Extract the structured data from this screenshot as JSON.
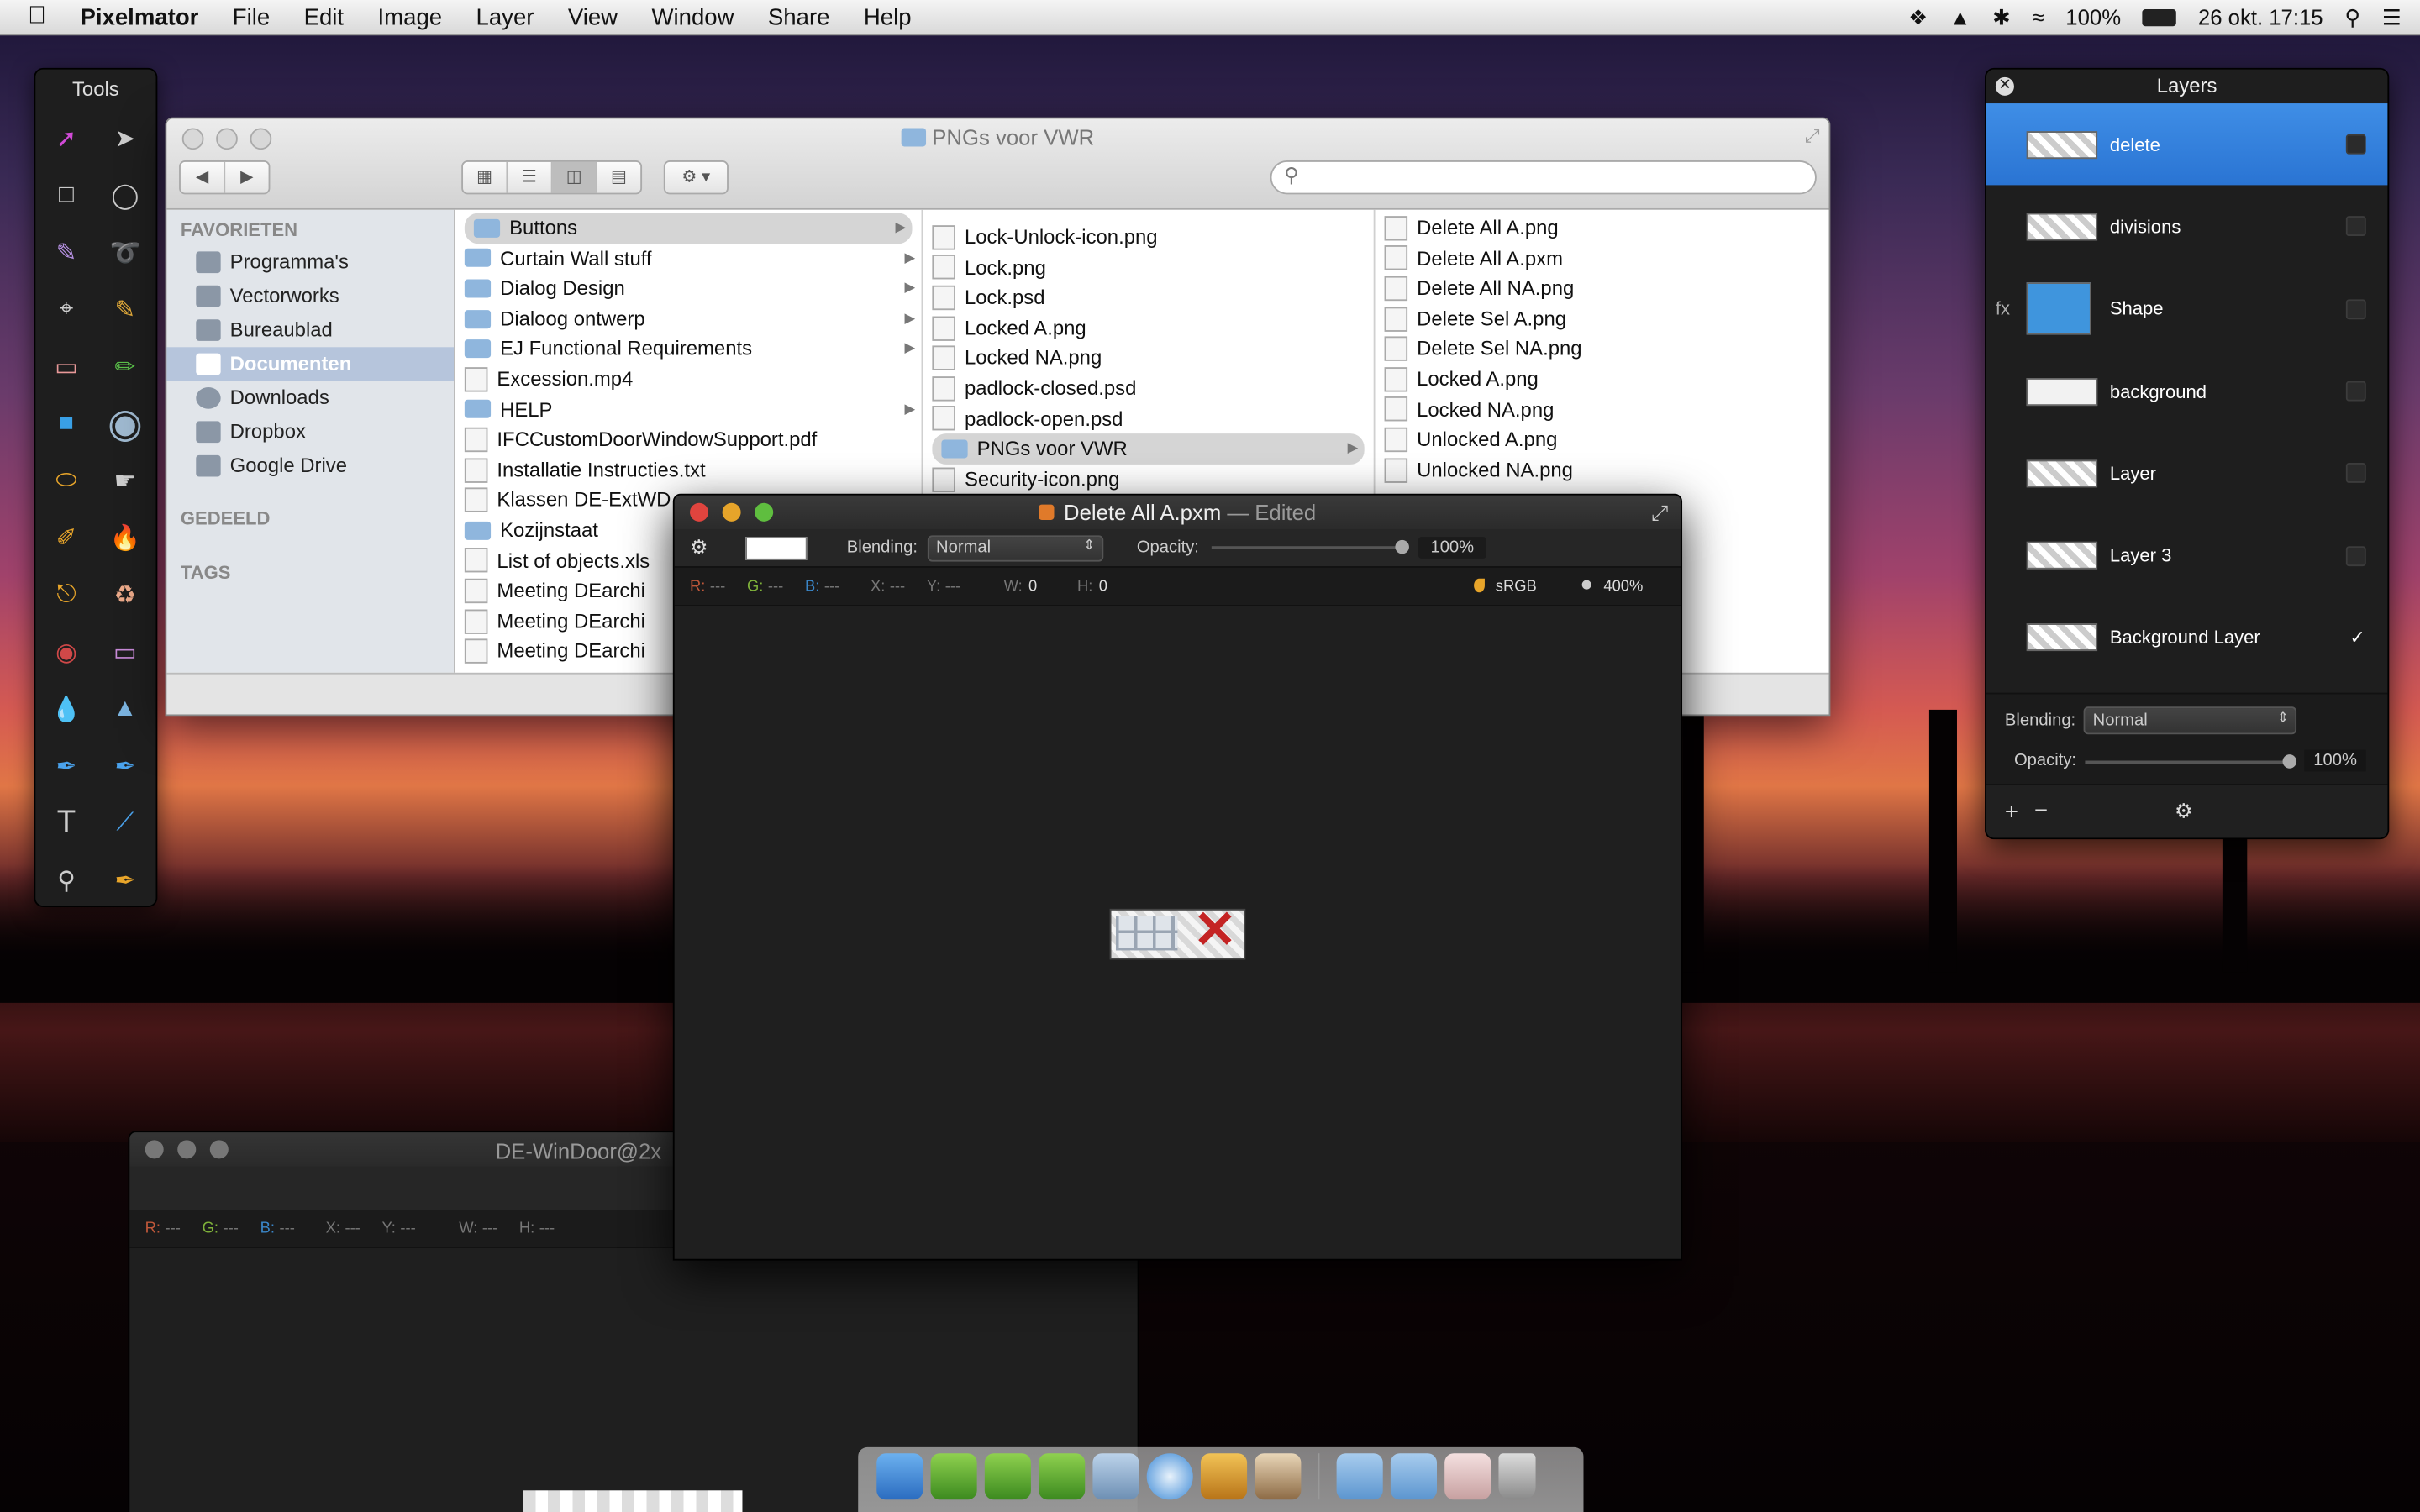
{
  "menubar": {
    "app": "Pixelmator",
    "menus": [
      "File",
      "Edit",
      "Image",
      "Layer",
      "View",
      "Window",
      "Share",
      "Help"
    ],
    "battery": "100%",
    "datetime": "26 okt. 17:15"
  },
  "tools": {
    "title": "Tools"
  },
  "finder": {
    "title": "PNGs voor VWR",
    "sidebar": {
      "favorites_header": "FAVORIETEN",
      "items": [
        "Programma's",
        "Vectorworks",
        "Bureaublad",
        "Documenten",
        "Downloads",
        "Dropbox",
        "Google Drive"
      ],
      "selected": "Documenten",
      "shared_header": "GEDEELD",
      "tags_header": "TAGS"
    },
    "col1": [
      {
        "name": "Buttons",
        "type": "folder",
        "sel": true,
        "arrow": true
      },
      {
        "name": "Curtain Wall stuff",
        "type": "folder",
        "arrow": true
      },
      {
        "name": "Dialog Design",
        "type": "folder",
        "arrow": true
      },
      {
        "name": "Dialoog ontwerp",
        "type": "folder",
        "arrow": true
      },
      {
        "name": "EJ Functional Requirements",
        "type": "folder",
        "arrow": true
      },
      {
        "name": "Excession.mp4",
        "type": "file"
      },
      {
        "name": "HELP",
        "type": "folder",
        "arrow": true
      },
      {
        "name": "IFCCustomDoorWindowSupport.pdf",
        "type": "file"
      },
      {
        "name": "Installatie Instructies.txt",
        "type": "file"
      },
      {
        "name": "Klassen DE-ExtWD",
        "type": "file"
      },
      {
        "name": "Kozijnstaat",
        "type": "folder"
      },
      {
        "name": "List of objects.xls",
        "type": "file"
      },
      {
        "name": "Meeting DEarchi",
        "type": "file"
      },
      {
        "name": "Meeting DEarchi",
        "type": "file"
      },
      {
        "name": "Meeting DEarchi",
        "type": "file"
      }
    ],
    "col2": [
      {
        "name": "Lock-Unlock-icon.png",
        "type": "file"
      },
      {
        "name": "Lock.png",
        "type": "file"
      },
      {
        "name": "Lock.psd",
        "type": "file"
      },
      {
        "name": "Locked A.png",
        "type": "file"
      },
      {
        "name": "Locked NA.png",
        "type": "file"
      },
      {
        "name": "padlock-closed.psd",
        "type": "file"
      },
      {
        "name": "padlock-open.psd",
        "type": "file"
      },
      {
        "name": "PNGs voor VWR",
        "type": "folder",
        "sel": true,
        "arrow": true
      },
      {
        "name": "Security-icon.png",
        "type": "file"
      }
    ],
    "col3": [
      {
        "name": "Delete All A.png",
        "type": "file"
      },
      {
        "name": "Delete All A.pxm",
        "type": "file"
      },
      {
        "name": "Delete All NA.png",
        "type": "file"
      },
      {
        "name": "Delete Sel A.png",
        "type": "file"
      },
      {
        "name": "Delete Sel NA.png",
        "type": "file"
      },
      {
        "name": "Locked A.png",
        "type": "file"
      },
      {
        "name": "Locked NA.png",
        "type": "file"
      },
      {
        "name": "Unlocked A.png",
        "type": "file"
      },
      {
        "name": "Unlocked NA.png",
        "type": "file"
      }
    ]
  },
  "doc": {
    "title": "Delete All A.pxm",
    "edited": "Edited",
    "blending_label": "Blending:",
    "blending_value": "Normal",
    "opacity_label": "Opacity:",
    "opacity_value": "100%",
    "r": "R:",
    "g": "G:",
    "b": "B:",
    "x": "X:",
    "y": "Y:",
    "dash": "---",
    "w_label": "W:",
    "w_value": "0",
    "h_label": "H:",
    "h_value": "0",
    "colorspace": "sRGB",
    "zoom": "400%"
  },
  "doc2": {
    "title": "DE-WinDoor@2x"
  },
  "layers": {
    "title": "Layers",
    "items": [
      {
        "name": "delete",
        "sel": true,
        "checked": false
      },
      {
        "name": "divisions",
        "checked": false
      },
      {
        "name": "Shape",
        "fx": true,
        "checked": false
      },
      {
        "name": "background",
        "checked": false
      },
      {
        "name": "Layer",
        "checked": false
      },
      {
        "name": "Layer 3",
        "checked": false
      },
      {
        "name": "Background Layer",
        "checked": true
      }
    ],
    "blending_label": "Blending:",
    "blending_value": "Normal",
    "opacity_label": "Opacity:",
    "opacity_value": "100%",
    "fx": "fx"
  },
  "colors": {
    "selection": "#2a74d3",
    "close": "#e0443e",
    "minimize": "#e6a42a",
    "zoom": "#5fbe3f"
  }
}
